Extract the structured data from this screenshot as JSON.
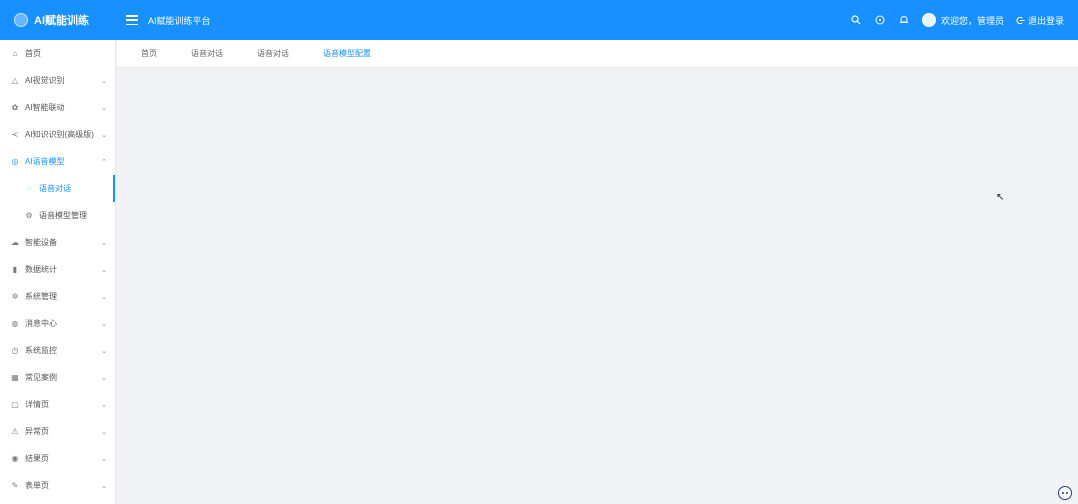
{
  "header": {
    "logo_text": "AI赋能训练",
    "platform_title": "AI赋能训练平台",
    "user_greeting": "欢迎您，管理员",
    "logout_label": "退出登录",
    "icons": [
      "search-icon",
      "help-icon",
      "bell-icon"
    ]
  },
  "sidebar": {
    "items": [
      {
        "label": "首页",
        "icon": "home-icon",
        "chevron": ""
      },
      {
        "label": "AI视觉识别",
        "icon": "vision-icon",
        "chevron": "⌄"
      },
      {
        "label": "AI智能联动",
        "icon": "link-icon",
        "chevron": "⌄"
      },
      {
        "label": "AI知识识别(高级版)",
        "icon": "share-icon",
        "chevron": "⌄"
      },
      {
        "label": "AI语音模型",
        "icon": "voice-icon",
        "chevron": "⌃"
      },
      {
        "label": "语音对话",
        "icon": "chat-icon",
        "chevron": ""
      },
      {
        "label": "语音模型管理",
        "icon": "gear-icon",
        "chevron": ""
      },
      {
        "label": "智能设备",
        "icon": "cloud-icon",
        "chevron": "⌄"
      },
      {
        "label": "数据统计",
        "icon": "chart-icon",
        "chevron": "⌄"
      },
      {
        "label": "系统管理",
        "icon": "settings-icon",
        "chevron": "⌄"
      },
      {
        "label": "消息中心",
        "icon": "message-icon",
        "chevron": "⌄"
      },
      {
        "label": "系统监控",
        "icon": "monitor-icon",
        "chevron": "⌄"
      },
      {
        "label": "常见案例",
        "icon": "grid-icon",
        "chevron": "⌄"
      },
      {
        "label": "详情页",
        "icon": "detail-icon",
        "chevron": "⌄"
      },
      {
        "label": "异常页",
        "icon": "warning-icon",
        "chevron": "⌄"
      },
      {
        "label": "结果页",
        "icon": "result-icon",
        "chevron": "⌄"
      },
      {
        "label": "表单页",
        "icon": "form-icon",
        "chevron": "⌄"
      }
    ]
  },
  "tabs": [
    {
      "label": "首页"
    },
    {
      "label": "语音对话"
    },
    {
      "label": "语音对话"
    },
    {
      "label": "语音模型配置"
    }
  ]
}
